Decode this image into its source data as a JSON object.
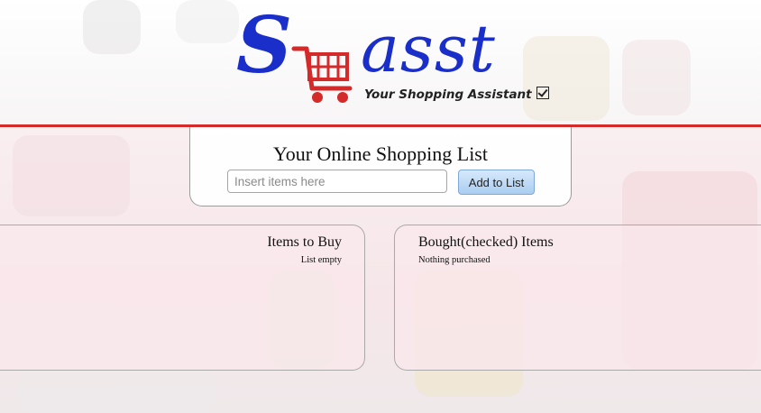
{
  "brand": {
    "logo_letter": "S",
    "logo_text": "asst",
    "tagline": "Your Shopping Assistant",
    "primary_color": "#1a2fc9",
    "cart_color": "#d42a2a",
    "accent_line_color": "#d42a2a"
  },
  "form": {
    "title": "Your Online Shopping List",
    "input_placeholder": "Insert items here",
    "input_value": "",
    "add_button_label": "Add to List"
  },
  "lists": {
    "to_buy": {
      "title": "Items to Buy",
      "empty_message": "List empty"
    },
    "bought": {
      "title": "Bought(checked) Items",
      "empty_message": "Nothing purchased"
    }
  },
  "icons": [
    "shopping-cart-icon",
    "checkbox-icon"
  ]
}
